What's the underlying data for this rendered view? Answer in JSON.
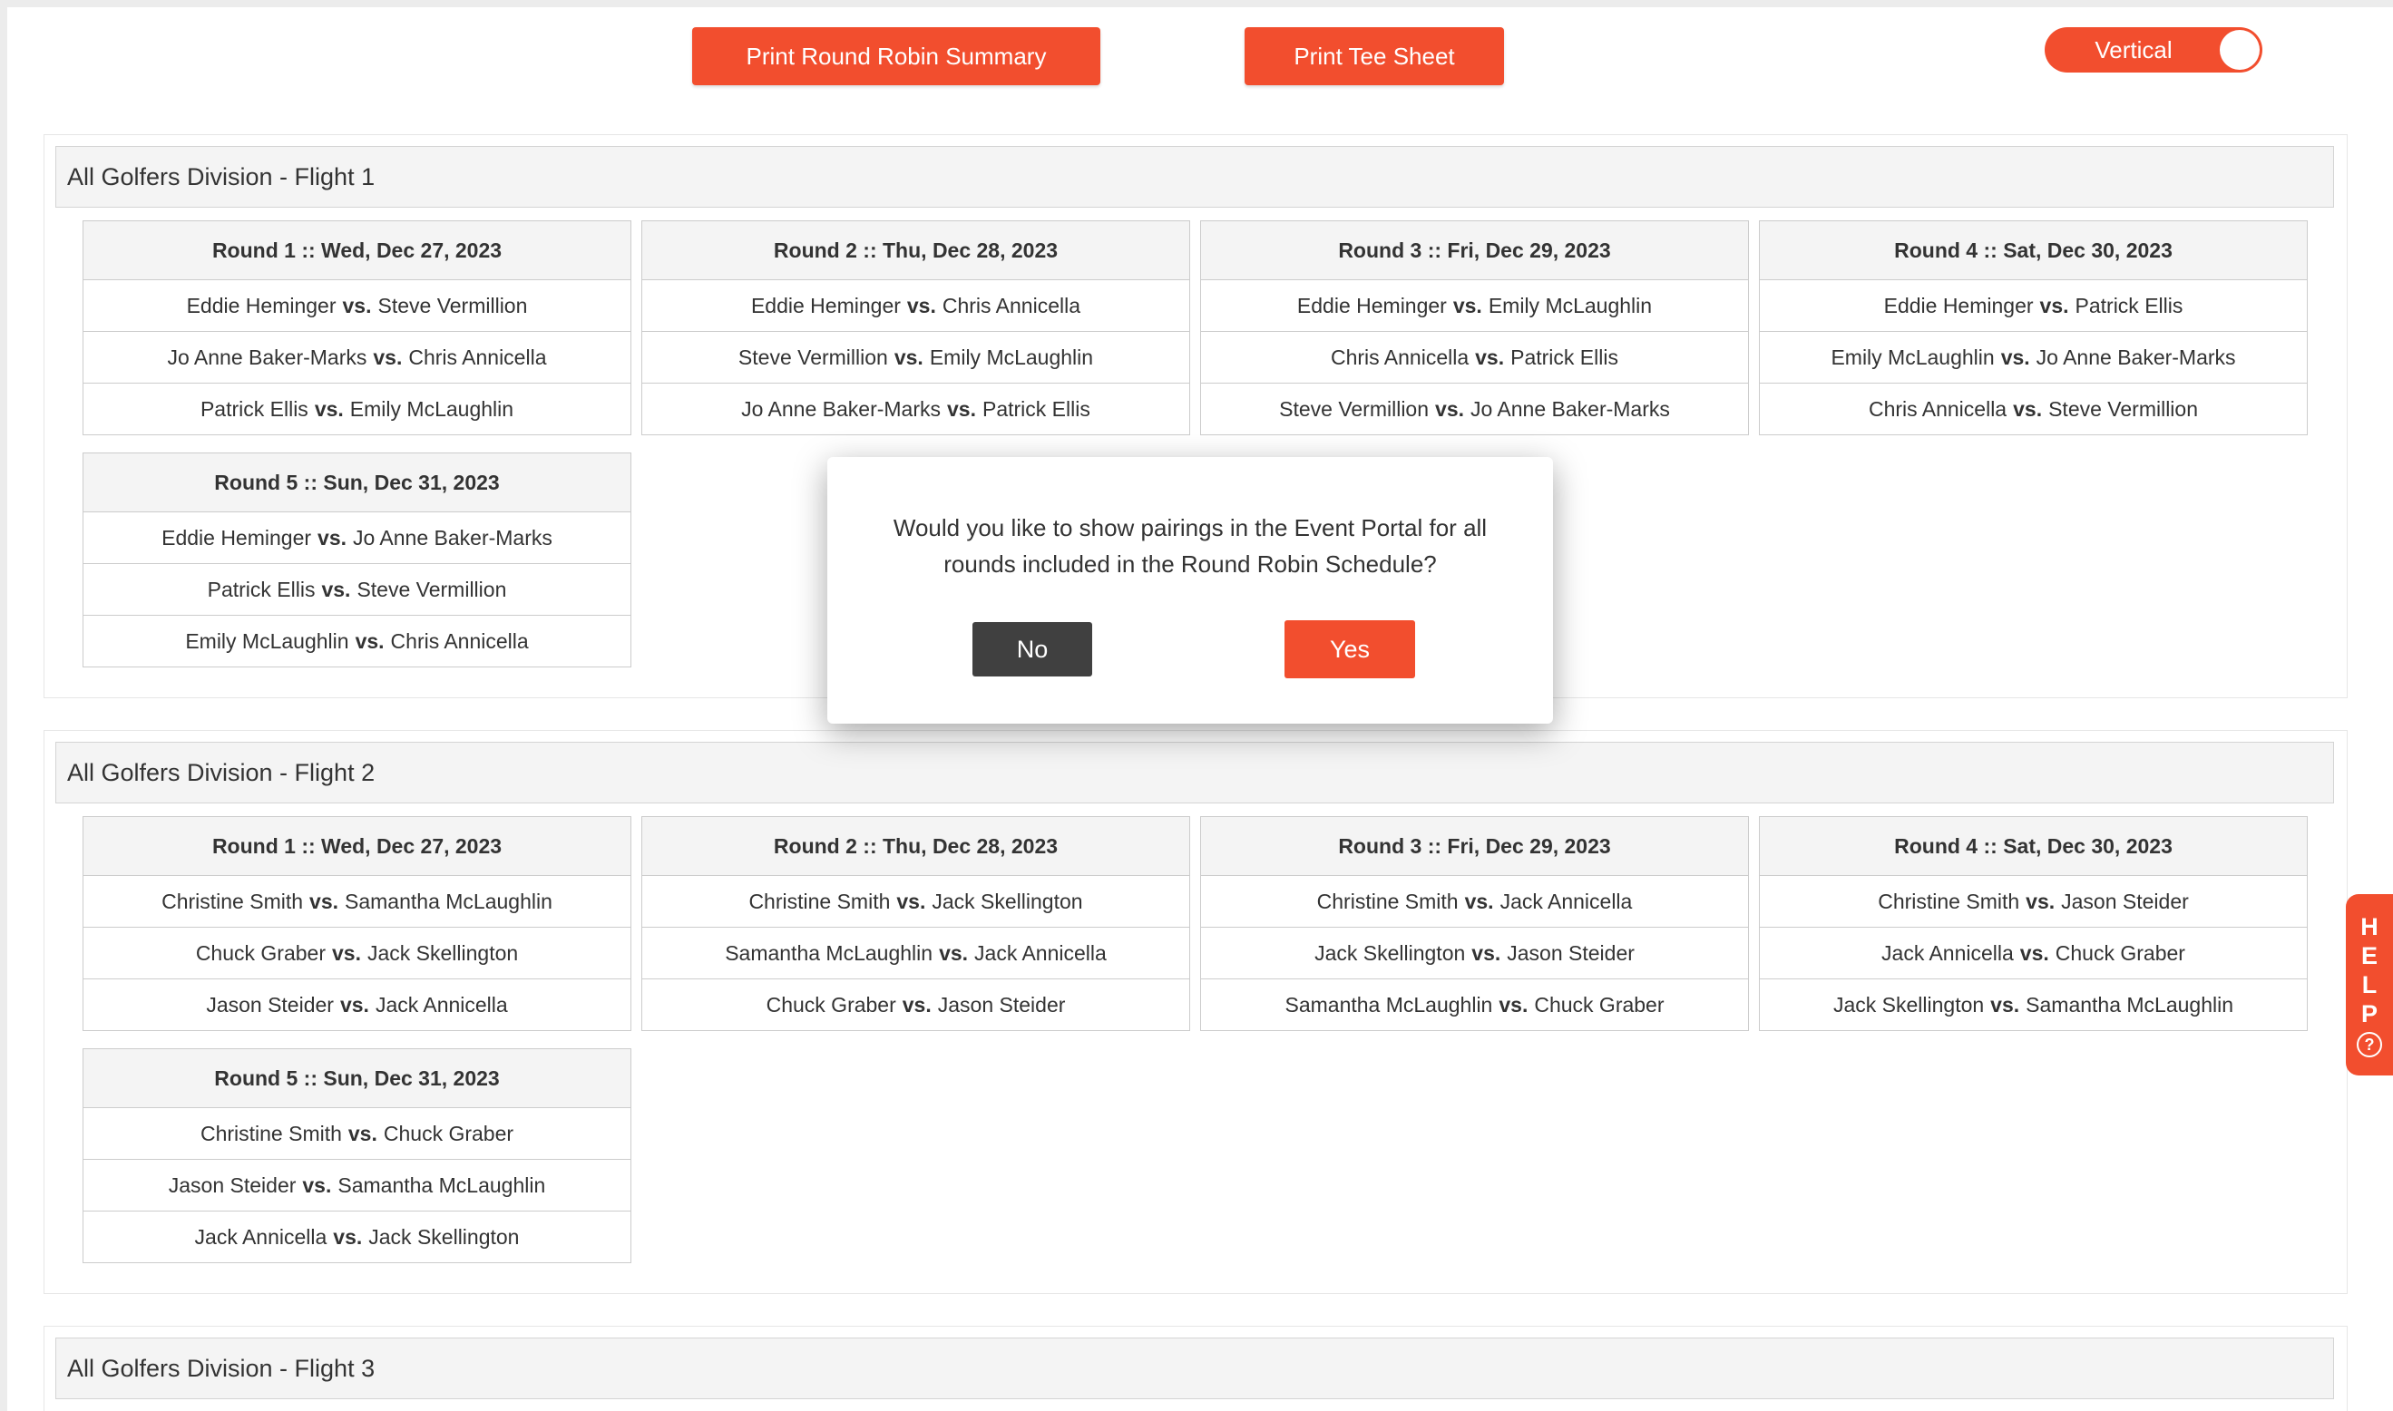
{
  "toolbar": {
    "print_summary_label": "Print Round Robin Summary",
    "print_tee_label": "Print Tee Sheet",
    "toggle_label": "Vertical"
  },
  "flights": [
    {
      "title": "All Golfers Division - Flight 1",
      "rounds": [
        {
          "title": "Round 1 :: Wed, Dec 27, 2023",
          "matches": [
            {
              "a": "Eddie Heminger",
              "b": "Steve Vermillion"
            },
            {
              "a": "Jo Anne Baker-Marks",
              "b": "Chris Annicella"
            },
            {
              "a": "Patrick Ellis",
              "b": "Emily McLaughlin"
            }
          ]
        },
        {
          "title": "Round 2 :: Thu, Dec 28, 2023",
          "matches": [
            {
              "a": "Eddie Heminger",
              "b": "Chris Annicella"
            },
            {
              "a": "Steve Vermillion",
              "b": "Emily McLaughlin"
            },
            {
              "a": "Jo Anne Baker-Marks",
              "b": "Patrick Ellis"
            }
          ]
        },
        {
          "title": "Round 3 :: Fri, Dec 29, 2023",
          "matches": [
            {
              "a": "Eddie Heminger",
              "b": "Emily McLaughlin"
            },
            {
              "a": "Chris Annicella",
              "b": "Patrick Ellis"
            },
            {
              "a": "Steve Vermillion",
              "b": "Jo Anne Baker-Marks"
            }
          ]
        },
        {
          "title": "Round 4 :: Sat, Dec 30, 2023",
          "matches": [
            {
              "a": "Eddie Heminger",
              "b": "Patrick Ellis"
            },
            {
              "a": "Emily McLaughlin",
              "b": "Jo Anne Baker-Marks"
            },
            {
              "a": "Chris Annicella",
              "b": "Steve Vermillion"
            }
          ]
        },
        {
          "title": "Round 5 :: Sun, Dec 31, 2023",
          "matches": [
            {
              "a": "Eddie Heminger",
              "b": "Jo Anne Baker-Marks"
            },
            {
              "a": "Patrick Ellis",
              "b": "Steve Vermillion"
            },
            {
              "a": "Emily McLaughlin",
              "b": "Chris Annicella"
            }
          ]
        }
      ]
    },
    {
      "title": "All Golfers Division - Flight 2",
      "rounds": [
        {
          "title": "Round 1 :: Wed, Dec 27, 2023",
          "matches": [
            {
              "a": "Christine Smith",
              "b": "Samantha McLaughlin"
            },
            {
              "a": "Chuck Graber",
              "b": "Jack Skellington"
            },
            {
              "a": "Jason Steider",
              "b": "Jack Annicella"
            }
          ]
        },
        {
          "title": "Round 2 :: Thu, Dec 28, 2023",
          "matches": [
            {
              "a": "Christine Smith",
              "b": "Jack Skellington"
            },
            {
              "a": "Samantha McLaughlin",
              "b": "Jack Annicella"
            },
            {
              "a": "Chuck Graber",
              "b": "Jason Steider"
            }
          ]
        },
        {
          "title": "Round 3 :: Fri, Dec 29, 2023",
          "matches": [
            {
              "a": "Christine Smith",
              "b": "Jack Annicella"
            },
            {
              "a": "Jack Skellington",
              "b": "Jason Steider"
            },
            {
              "a": "Samantha McLaughlin",
              "b": "Chuck Graber"
            }
          ]
        },
        {
          "title": "Round 4 :: Sat, Dec 30, 2023",
          "matches": [
            {
              "a": "Christine Smith",
              "b": "Jason Steider"
            },
            {
              "a": "Jack Annicella",
              "b": "Chuck Graber"
            },
            {
              "a": "Jack Skellington",
              "b": "Samantha McLaughlin"
            }
          ]
        },
        {
          "title": "Round 5 :: Sun, Dec 31, 2023",
          "matches": [
            {
              "a": "Christine Smith",
              "b": "Chuck Graber"
            },
            {
              "a": "Jason Steider",
              "b": "Samantha McLaughlin"
            },
            {
              "a": "Jack Annicella",
              "b": "Jack Skellington"
            }
          ]
        }
      ]
    },
    {
      "title": "All Golfers Division - Flight 3",
      "rounds": []
    }
  ],
  "vs_label": "vs.",
  "modal": {
    "message": "Would you like to show pairings in the Event Portal for all rounds included in the Round Robin Schedule?",
    "no_label": "No",
    "yes_label": "Yes"
  },
  "help": {
    "letters": [
      "H",
      "E",
      "L",
      "P"
    ],
    "icon_glyph": "?"
  },
  "colors": {
    "accent": "#f24e2e",
    "dark_button": "#404040",
    "header_bg": "#f4f4f4"
  }
}
